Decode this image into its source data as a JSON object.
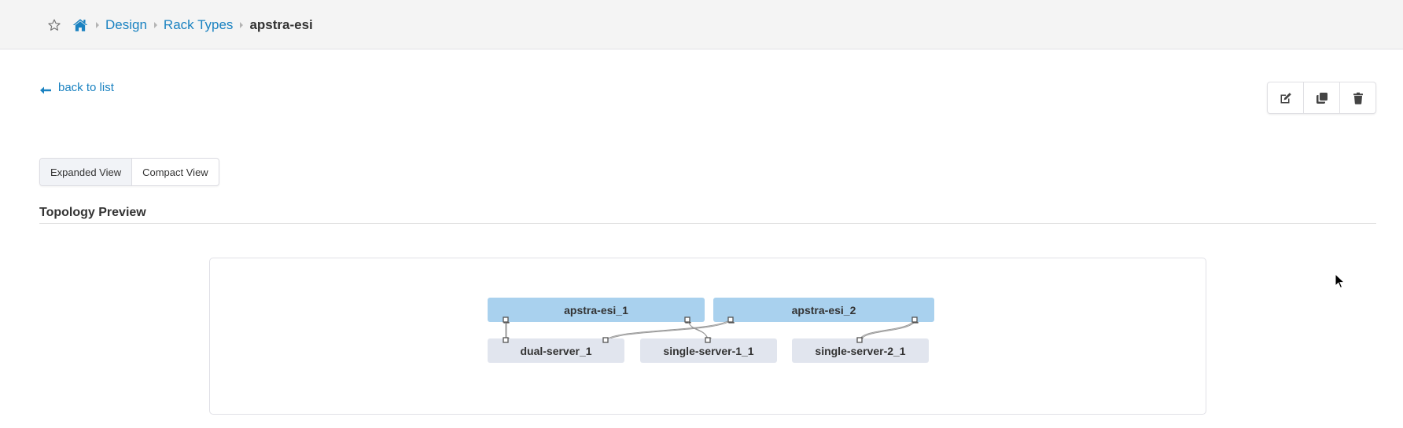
{
  "header": {
    "favorite_icon": "star-outline-icon",
    "home_icon": "home-icon",
    "breadcrumb": [
      {
        "label": "Design",
        "link": true
      },
      {
        "label": "Rack Types",
        "link": true
      },
      {
        "label": "apstra-esi",
        "link": false
      }
    ]
  },
  "page": {
    "back_label": "back to list",
    "actions": [
      {
        "name": "edit",
        "icon": "edit-icon"
      },
      {
        "name": "clone",
        "icon": "clone-icon"
      },
      {
        "name": "delete",
        "icon": "trash-icon"
      }
    ],
    "view_toggle": {
      "options": [
        "Expanded View",
        "Compact View"
      ],
      "selected": "Expanded View"
    },
    "section_title": "Topology Preview"
  },
  "topology": {
    "leafs": [
      {
        "label": "apstra-esi_1"
      },
      {
        "label": "apstra-esi_2"
      }
    ],
    "servers": [
      {
        "label": "dual-server_1"
      },
      {
        "label": "single-server-1_1"
      },
      {
        "label": "single-server-2_1"
      }
    ],
    "links": [
      {
        "from": "apstra-esi_1",
        "to": "dual-server_1"
      },
      {
        "from": "apstra-esi_2",
        "to": "dual-server_1"
      },
      {
        "from": "apstra-esi_1",
        "to": "single-server-1_1"
      },
      {
        "from": "apstra-esi_2",
        "to": "single-server-2_1"
      }
    ]
  },
  "colors": {
    "link": "#1a82c1",
    "leaf": "#a9d1ee",
    "server": "#e1e5ee"
  }
}
